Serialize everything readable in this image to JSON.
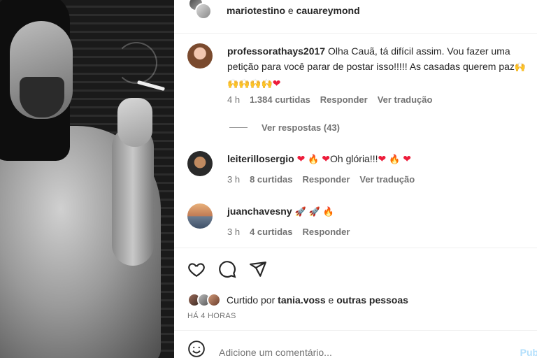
{
  "header": {
    "user1": "mariotestino",
    "conj": "e",
    "user2": "cauareymond"
  },
  "comments": [
    {
      "username": "professorathays2017",
      "text": "Olha Cauã, tá difícil assim. Vou fazer uma petição para você parar de postar isso!!!!! As casadas querem paz",
      "emoji_trail": [
        "🙌",
        "🙌",
        "🙌",
        "🙌",
        "🙌",
        "❤"
      ],
      "time": "4 h",
      "likes": "1.384 curtidas",
      "reply": "Responder",
      "translate": "Ver tradução",
      "view_replies": "Ver respostas (43)"
    },
    {
      "username": "leiterillosergio",
      "pre_emoji": [
        "❤",
        "🔥",
        "❤"
      ],
      "text": "Oh glória!!!",
      "post_emoji": [
        "❤",
        "🔥",
        "❤"
      ],
      "time": "3 h",
      "likes": "8 curtidas",
      "reply": "Responder",
      "translate": "Ver tradução"
    },
    {
      "username": "juanchavesny",
      "emoji": [
        "🚀",
        "🚀",
        "🔥"
      ],
      "time": "3 h",
      "likes": "4 curtidas",
      "reply": "Responder"
    }
  ],
  "likes_summary": {
    "prefix": "Curtido por",
    "user": "tania.voss",
    "conj": "e",
    "others": "outras pessoas"
  },
  "time_ago": "HÁ 4 HORAS",
  "add_comment": {
    "placeholder": "Adicione um comentário...",
    "post_label": "Publ"
  },
  "icons": {
    "like": "heart-outline-icon",
    "comment": "comment-bubble-icon",
    "share": "paper-plane-icon",
    "emoji": "smiley-icon"
  },
  "colors": {
    "heart": "#ed1c3a",
    "muted": "#737373",
    "post_button": "#b2dffc"
  }
}
